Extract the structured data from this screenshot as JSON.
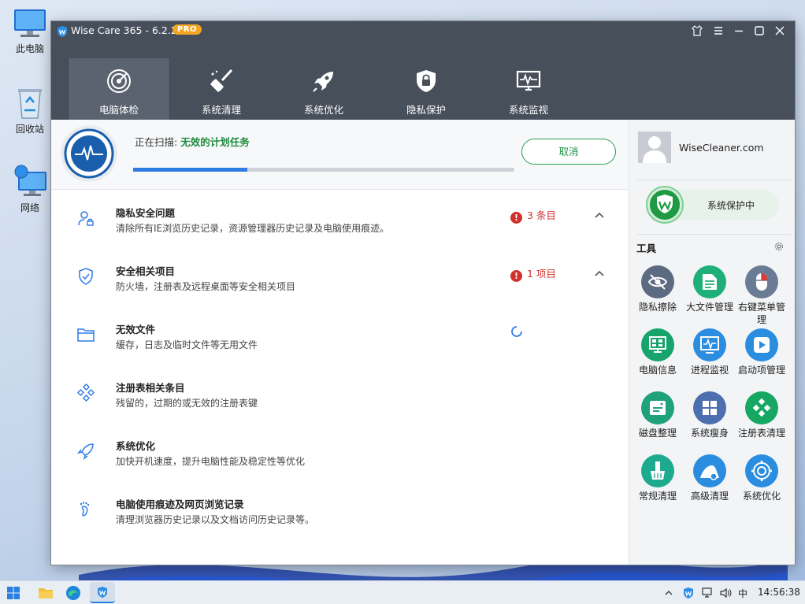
{
  "desktop": {
    "icons": [
      {
        "label": "此电脑",
        "icon": "computer-icon"
      },
      {
        "label": "回收站",
        "icon": "recycle-bin-icon"
      },
      {
        "label": "网络",
        "icon": "network-icon"
      }
    ]
  },
  "window": {
    "title": "Wise Care 365 - 6.2.2",
    "badge": "PRO",
    "tabs": [
      {
        "label": "电脑体检",
        "icon": "radar-icon",
        "active": true
      },
      {
        "label": "系统清理",
        "icon": "broom-icon"
      },
      {
        "label": "系统优化",
        "icon": "rocket-icon"
      },
      {
        "label": "隐私保护",
        "icon": "lock-shield-icon"
      },
      {
        "label": "系统监视",
        "icon": "monitor-pulse-icon"
      }
    ]
  },
  "scan": {
    "prefix": "正在扫描:",
    "task": "无效的计划任务",
    "progress": 0.3,
    "cancel_label": "取消"
  },
  "items": [
    {
      "title": "隐私安全问题",
      "desc": "清除所有IE浏览历史记录，资源管理器历史记录及电脑使用痕迹。",
      "count": "3 条目"
    },
    {
      "title": "安全相关项目",
      "desc": "防火墙，注册表及远程桌面等安全相关项目",
      "count": "1 项目"
    },
    {
      "title": "无效文件",
      "desc": "缓存，日志及临时文件等无用文件"
    },
    {
      "title": "注册表相关条目",
      "desc": "残留的，过期的或无效的注册表键"
    },
    {
      "title": "系统优化",
      "desc": "加快开机速度，提升电脑性能及稳定性等优化"
    },
    {
      "title": "电脑使用痕迹及网页浏览记录",
      "desc": "清理浏览器历史记录以及文档访问历史记录等。"
    }
  ],
  "sidebar": {
    "site": "WiseCleaner.com",
    "protect_label": "系统保护中",
    "tools_title": "工具",
    "tools": [
      {
        "label": "隐私擦除",
        "color": "#5c6b82",
        "icon": "eye-slash-icon"
      },
      {
        "label": "大文件管理",
        "color": "#1fb07a",
        "icon": "file-list-icon"
      },
      {
        "label": "右键菜单管理",
        "color": "#6a7b96",
        "icon": "mouse-icon"
      },
      {
        "label": "电脑信息",
        "color": "#17a36c",
        "icon": "pc-info-icon"
      },
      {
        "label": "进程监视",
        "color": "#2a8de0",
        "icon": "process-monitor-icon"
      },
      {
        "label": "启动项管理",
        "color": "#2a8de0",
        "icon": "play-icon"
      },
      {
        "label": "磁盘整理",
        "color": "#1fa27a",
        "icon": "disk-icon"
      },
      {
        "label": "系统瘦身",
        "color": "#4d6fb0",
        "icon": "windows-icon"
      },
      {
        "label": "注册表清理",
        "color": "#16a863",
        "icon": "registry-icon"
      },
      {
        "label": "常规清理",
        "color": "#1eaa8f",
        "icon": "broom-clean-icon"
      },
      {
        "label": "高级清理",
        "color": "#2a8de0",
        "icon": "advanced-clean-icon"
      },
      {
        "label": "系统优化",
        "color": "#2a8de0",
        "icon": "gear-optimize-icon"
      }
    ]
  },
  "taskbar": {
    "ime": "中",
    "time": "14:56:38"
  }
}
